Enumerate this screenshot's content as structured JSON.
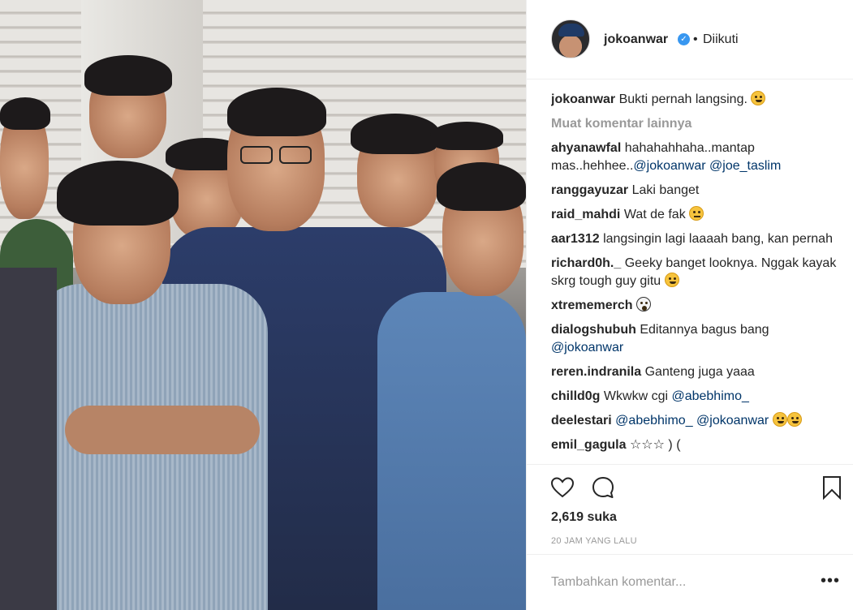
{
  "post": {
    "username": "jokoanwar",
    "verified_icon": "verified-badge-icon",
    "separator": "•",
    "follow_status": "Diikuti"
  },
  "comments": {
    "caption": {
      "user": "jokoanwar",
      "text": "Bukti pernah langsing."
    },
    "load_more": "Muat komentar lainnya",
    "items": [
      {
        "user": "ahyanawfal",
        "text": "hahahahhaha..mantap mas..hehhee..",
        "mention1": "@jokoanwar",
        "mention2": "@joe_taslim"
      },
      {
        "user": "ranggayuzar",
        "text": "Laki banget"
      },
      {
        "user": "raid_mahdi",
        "text": "Wat de fak"
      },
      {
        "user": "aar1312",
        "text": "langsingin lagi laaaah bang, kan pernah"
      },
      {
        "user": "richard0h._",
        "text": "Geeky banget looknya. Nggak kayak skrg tough guy gitu"
      },
      {
        "user": "xtrememerch",
        "text": ""
      },
      {
        "user": "dialogshubuh",
        "text": "Editannya bagus bang",
        "mention1": "@jokoanwar"
      },
      {
        "user": "reren.indranila",
        "text": "Ganteng juga yaaa"
      },
      {
        "user": "chilld0g",
        "text": "Wkwkw cgi",
        "mention1": "@abebhimo_"
      },
      {
        "user": "deelestari",
        "text": "",
        "mention1": "@abebhimo_",
        "mention2": "@jokoanwar"
      },
      {
        "user": "emil_gagula",
        "text": "☆☆☆ ) ("
      }
    ]
  },
  "actions": {
    "like_icon": "heart-icon",
    "comment_icon": "comment-icon",
    "save_icon": "bookmark-icon",
    "likes": "2,619 suka",
    "time": "20 JAM YANG LALU",
    "add_comment_placeholder": "Tambahkan komentar...",
    "options_label": "•••"
  },
  "colors": {
    "link": "#003569",
    "verified": "#3897f0",
    "muted": "#999999"
  }
}
